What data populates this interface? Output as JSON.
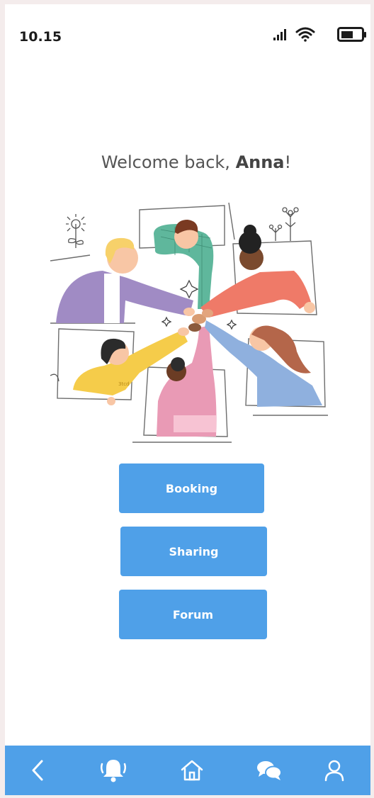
{
  "status_bar": {
    "time": "10.15",
    "icons": [
      "signal-icon",
      "wifi-icon",
      "battery-icon"
    ]
  },
  "welcome": {
    "prefix": "Welcome back, ",
    "name": "Anna",
    "suffix": "!"
  },
  "illustration": {
    "icon": "team-hands-together-illustration",
    "badge_text": "3tcd"
  },
  "buttons": {
    "booking_label": "Booking",
    "sharing_label": "Sharing",
    "forum_label": "Forum"
  },
  "bottom_nav": {
    "items": [
      "back-icon",
      "bell-icon",
      "home-icon",
      "chat-icon",
      "profile-icon"
    ]
  },
  "colors": {
    "accent": "#4fa0e8",
    "background": "#ffffff",
    "frame": "#f4ecec",
    "text": "#555555"
  }
}
